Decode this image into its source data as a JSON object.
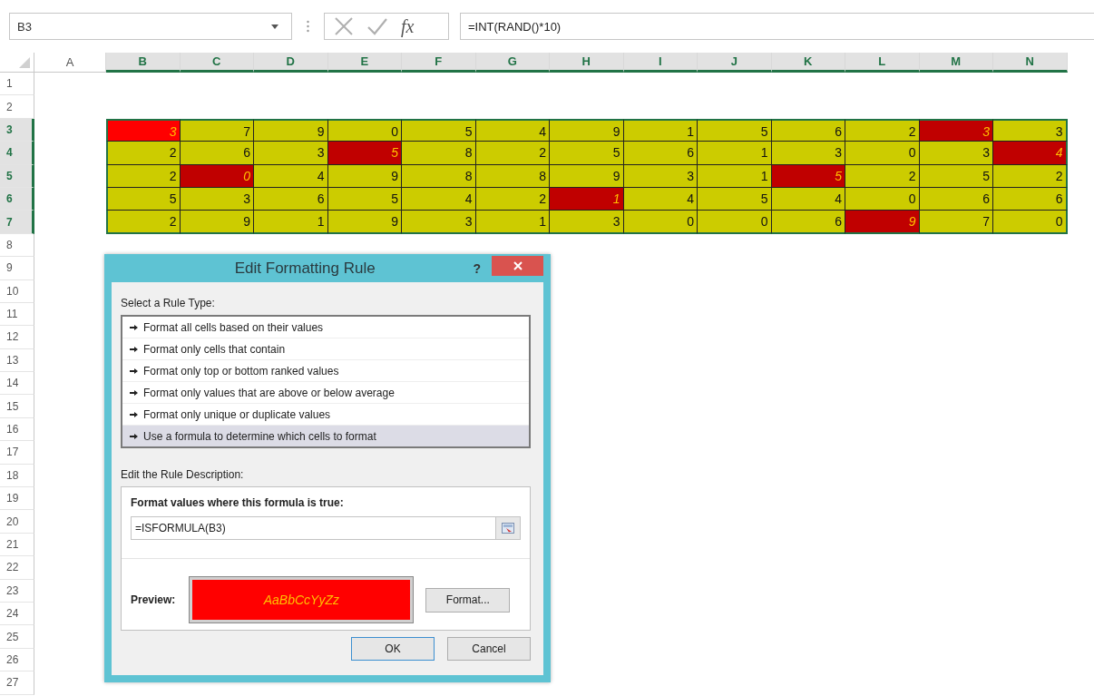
{
  "formula_bar": {
    "name_box": "B3",
    "function_label": "fx",
    "formula": "=INT(RAND()*10)"
  },
  "sheet": {
    "columns": [
      {
        "label": "A",
        "selected": false
      },
      {
        "label": "B",
        "selected": true
      },
      {
        "label": "C",
        "selected": true
      },
      {
        "label": "D",
        "selected": true
      },
      {
        "label": "E",
        "selected": true
      },
      {
        "label": "F",
        "selected": true
      },
      {
        "label": "G",
        "selected": true
      },
      {
        "label": "H",
        "selected": true
      },
      {
        "label": "I",
        "selected": true
      },
      {
        "label": "J",
        "selected": true
      },
      {
        "label": "K",
        "selected": true
      },
      {
        "label": "L",
        "selected": true
      },
      {
        "label": "M",
        "selected": true
      },
      {
        "label": "N",
        "selected": true
      }
    ],
    "rows": [
      {
        "label": "1",
        "selected": false
      },
      {
        "label": "2",
        "selected": false
      },
      {
        "label": "3",
        "selected": true,
        "cells": [
          {
            "value": "3",
            "highlighted": true,
            "active": true
          },
          {
            "value": "7",
            "highlighted": false,
            "active": false
          },
          {
            "value": "9",
            "highlighted": false,
            "active": false
          },
          {
            "value": "0",
            "highlighted": false,
            "active": false
          },
          {
            "value": "5",
            "highlighted": false,
            "active": false
          },
          {
            "value": "4",
            "highlighted": false,
            "active": false
          },
          {
            "value": "9",
            "highlighted": false,
            "active": false
          },
          {
            "value": "1",
            "highlighted": false,
            "active": false
          },
          {
            "value": "5",
            "highlighted": false,
            "active": false
          },
          {
            "value": "6",
            "highlighted": false,
            "active": false
          },
          {
            "value": "2",
            "highlighted": false,
            "active": false
          },
          {
            "value": "3",
            "highlighted": true,
            "active": false
          },
          {
            "value": "3",
            "highlighted": false,
            "active": false
          }
        ]
      },
      {
        "label": "4",
        "selected": true,
        "cells": [
          {
            "value": "2",
            "highlighted": false,
            "active": false
          },
          {
            "value": "6",
            "highlighted": false,
            "active": false
          },
          {
            "value": "3",
            "highlighted": false,
            "active": false
          },
          {
            "value": "5",
            "highlighted": true,
            "active": false
          },
          {
            "value": "8",
            "highlighted": false,
            "active": false
          },
          {
            "value": "2",
            "highlighted": false,
            "active": false
          },
          {
            "value": "5",
            "highlighted": false,
            "active": false
          },
          {
            "value": "6",
            "highlighted": false,
            "active": false
          },
          {
            "value": "1",
            "highlighted": false,
            "active": false
          },
          {
            "value": "3",
            "highlighted": false,
            "active": false
          },
          {
            "value": "0",
            "highlighted": false,
            "active": false
          },
          {
            "value": "3",
            "highlighted": false,
            "active": false
          },
          {
            "value": "4",
            "highlighted": true,
            "active": false
          }
        ]
      },
      {
        "label": "5",
        "selected": true,
        "cells": [
          {
            "value": "2",
            "highlighted": false,
            "active": false
          },
          {
            "value": "0",
            "highlighted": true,
            "active": false
          },
          {
            "value": "4",
            "highlighted": false,
            "active": false
          },
          {
            "value": "9",
            "highlighted": false,
            "active": false
          },
          {
            "value": "8",
            "highlighted": false,
            "active": false
          },
          {
            "value": "8",
            "highlighted": false,
            "active": false
          },
          {
            "value": "9",
            "highlighted": false,
            "active": false
          },
          {
            "value": "3",
            "highlighted": false,
            "active": false
          },
          {
            "value": "1",
            "highlighted": false,
            "active": false
          },
          {
            "value": "5",
            "highlighted": true,
            "active": false
          },
          {
            "value": "2",
            "highlighted": false,
            "active": false
          },
          {
            "value": "5",
            "highlighted": false,
            "active": false
          },
          {
            "value": "2",
            "highlighted": false,
            "active": false
          }
        ]
      },
      {
        "label": "6",
        "selected": true,
        "cells": [
          {
            "value": "5",
            "highlighted": false,
            "active": false
          },
          {
            "value": "3",
            "highlighted": false,
            "active": false
          },
          {
            "value": "6",
            "highlighted": false,
            "active": false
          },
          {
            "value": "5",
            "highlighted": false,
            "active": false
          },
          {
            "value": "4",
            "highlighted": false,
            "active": false
          },
          {
            "value": "2",
            "highlighted": false,
            "active": false
          },
          {
            "value": "1",
            "highlighted": true,
            "active": false
          },
          {
            "value": "4",
            "highlighted": false,
            "active": false
          },
          {
            "value": "5",
            "highlighted": false,
            "active": false
          },
          {
            "value": "4",
            "highlighted": false,
            "active": false
          },
          {
            "value": "0",
            "highlighted": false,
            "active": false
          },
          {
            "value": "6",
            "highlighted": false,
            "active": false
          },
          {
            "value": "6",
            "highlighted": false,
            "active": false
          }
        ]
      },
      {
        "label": "7",
        "selected": true,
        "cells": [
          {
            "value": "2",
            "highlighted": false,
            "active": false
          },
          {
            "value": "9",
            "highlighted": false,
            "active": false
          },
          {
            "value": "1",
            "highlighted": false,
            "active": false
          },
          {
            "value": "9",
            "highlighted": false,
            "active": false
          },
          {
            "value": "3",
            "highlighted": false,
            "active": false
          },
          {
            "value": "1",
            "highlighted": false,
            "active": false
          },
          {
            "value": "3",
            "highlighted": false,
            "active": false
          },
          {
            "value": "0",
            "highlighted": false,
            "active": false
          },
          {
            "value": "0",
            "highlighted": false,
            "active": false
          },
          {
            "value": "6",
            "highlighted": false,
            "active": false
          },
          {
            "value": "9",
            "highlighted": true,
            "active": false
          },
          {
            "value": "7",
            "highlighted": false,
            "active": false
          },
          {
            "value": "0",
            "highlighted": false,
            "active": false
          }
        ]
      },
      {
        "label": "8",
        "selected": false
      },
      {
        "label": "9",
        "selected": false
      },
      {
        "label": "10",
        "selected": false
      },
      {
        "label": "11",
        "selected": false
      },
      {
        "label": "12",
        "selected": false
      },
      {
        "label": "13",
        "selected": false
      },
      {
        "label": "14",
        "selected": false
      },
      {
        "label": "15",
        "selected": false
      },
      {
        "label": "16",
        "selected": false
      },
      {
        "label": "17",
        "selected": false
      },
      {
        "label": "18",
        "selected": false
      },
      {
        "label": "19",
        "selected": false
      },
      {
        "label": "20",
        "selected": false
      },
      {
        "label": "21",
        "selected": false
      },
      {
        "label": "22",
        "selected": false
      },
      {
        "label": "23",
        "selected": false
      },
      {
        "label": "24",
        "selected": false
      },
      {
        "label": "25",
        "selected": false
      },
      {
        "label": "26",
        "selected": false
      },
      {
        "label": "27",
        "selected": false
      }
    ]
  },
  "dialog": {
    "title": "Edit Formatting Rule",
    "help": "?",
    "rule_type_label": "Select a Rule Type:",
    "rule_types": [
      {
        "label": "Format all cells based on their values",
        "selected": false
      },
      {
        "label": "Format only cells that contain",
        "selected": false
      },
      {
        "label": "Format only top or bottom ranked values",
        "selected": false
      },
      {
        "label": "Format only values that are above or below average",
        "selected": false
      },
      {
        "label": "Format only unique or duplicate values",
        "selected": false
      },
      {
        "label": "Use a formula to determine which cells to format",
        "selected": true
      }
    ],
    "description_label": "Edit the Rule Description:",
    "formula_label": "Format values where this formula is true:",
    "formula": "=ISFORMULA(B3)",
    "preview_label": "Preview:",
    "preview_sample": "AaBbCcYyZz",
    "format_button": "Format...",
    "buttons": [
      {
        "label": "OK",
        "default": true
      },
      {
        "label": "Cancel",
        "default": false
      }
    ]
  }
}
